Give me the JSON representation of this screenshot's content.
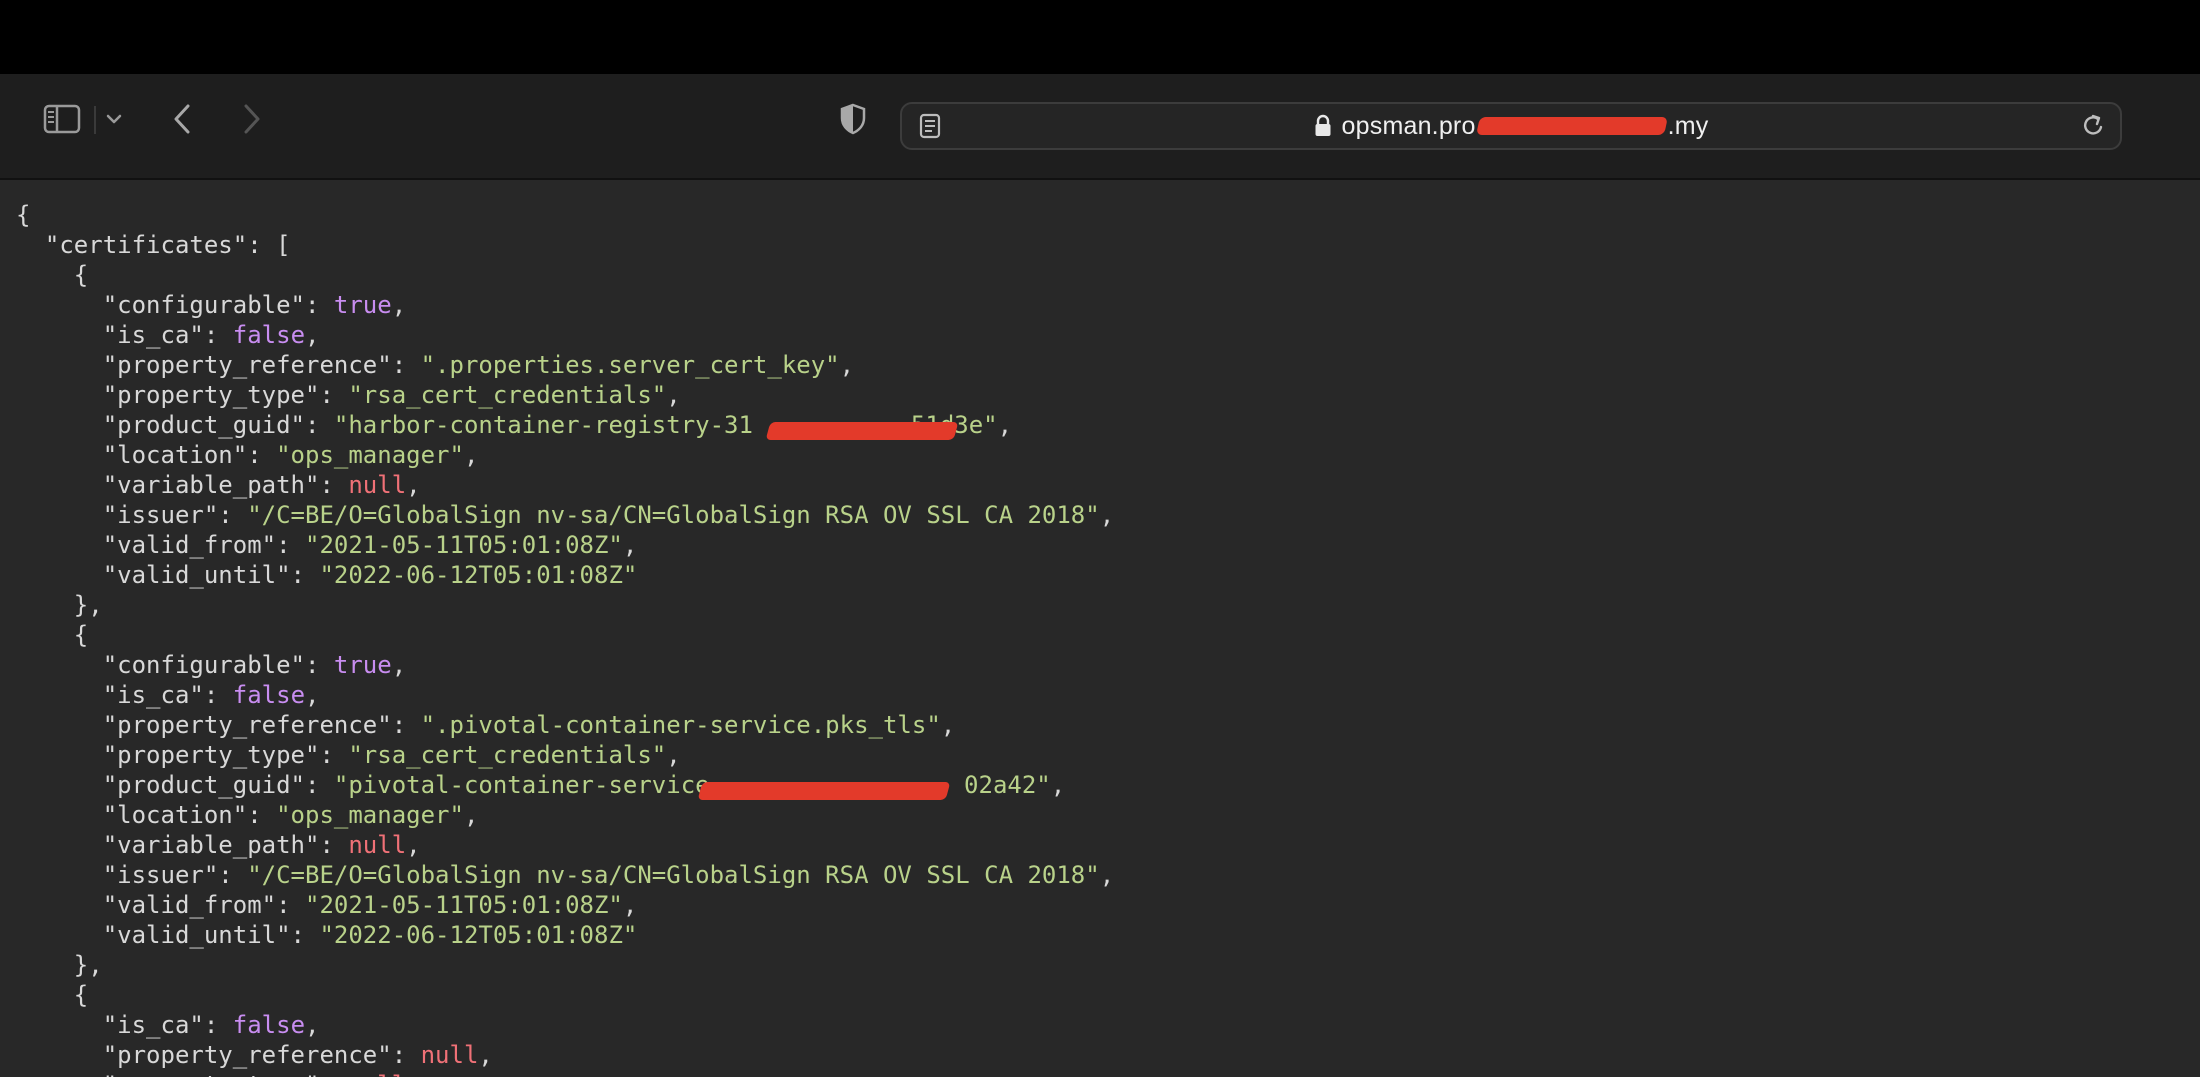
{
  "browser": {
    "url_prefix": "opsman.pro",
    "url_suffix": ".my",
    "icons": [
      "sidebar-icon",
      "chevron-down-icon",
      "back-arrow-icon",
      "forward-arrow-icon",
      "privacy-shield-icon",
      "page-reader-icon",
      "lock-icon",
      "reload-icon"
    ]
  },
  "json": {
    "open_brace": "{",
    "root_key": "\"certificates\"",
    "open_bracket": "[",
    "obj_open": "{",
    "obj_close_comma": "},",
    "cert1": {
      "configurable": "true",
      "is_ca": "false",
      "property_reference": "\".properties.server_cert_key\"",
      "property_type": "\"rsa_cert_credentials\"",
      "product_guid_start": "\"harbor-container-registry-31",
      "product_guid_end": "51d3e\"",
      "location": "\"ops_manager\"",
      "variable_path": "null",
      "issuer": "\"/C=BE/O=GlobalSign nv-sa/CN=GlobalSign RSA OV SSL CA 2018\"",
      "valid_from": "\"2021-05-11T05:01:08Z\"",
      "valid_until": "\"2022-06-12T05:01:08Z\""
    },
    "cert2": {
      "configurable": "true",
      "is_ca": "false",
      "property_reference": "\".pivotal-container-service.pks_tls\"",
      "property_type": "\"rsa_cert_credentials\"",
      "product_guid_start": "\"pivotal-container-service-",
      "product_guid_end": "02a42\"",
      "location": "\"ops_manager\"",
      "variable_path": "null",
      "issuer": "\"/C=BE/O=GlobalSign nv-sa/CN=GlobalSign RSA OV SSL CA 2018\"",
      "valid_from": "\"2021-05-11T05:01:08Z\"",
      "valid_until": "\"2022-06-12T05:01:08Z\""
    },
    "cert3": {
      "is_ca": "false",
      "property_reference": "null",
      "property_type_partial": "null"
    },
    "keys": {
      "configurable": "\"configurable\"",
      "is_ca": "\"is_ca\"",
      "property_reference": "\"property_reference\"",
      "property_type": "\"property_type\"",
      "product_guid": "\"product_guid\"",
      "location": "\"location\"",
      "variable_path": "\"variable_path\"",
      "issuer": "\"issuer\"",
      "valid_from": "\"valid_from\"",
      "valid_until": "\"valid_until\""
    }
  }
}
